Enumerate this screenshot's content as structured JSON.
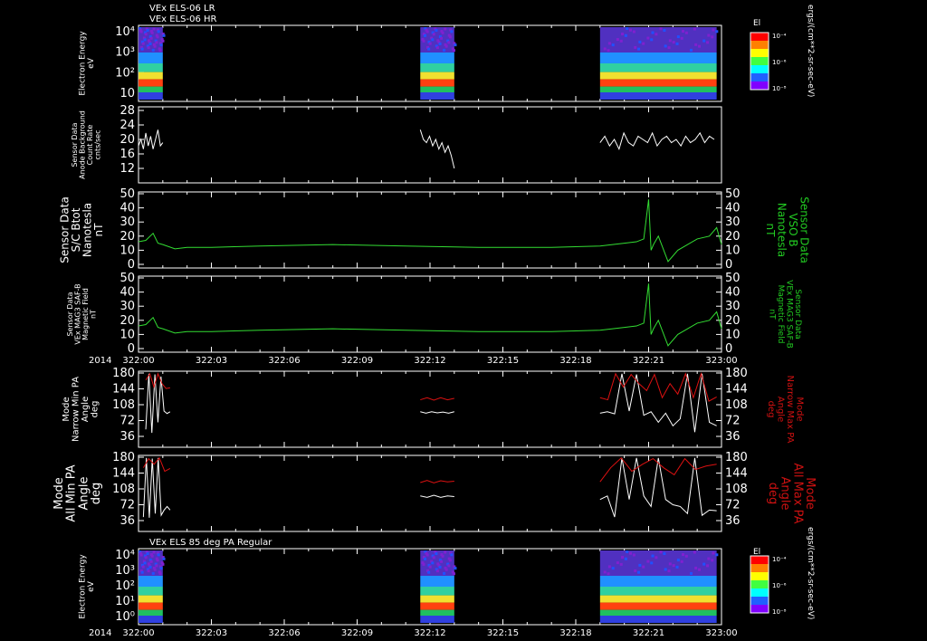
{
  "header": {
    "title_lr": "VEx ELS-06 LR",
    "title_hr": "VEx ELS-06 HR",
    "bottom_title": "VEx ELS 85 deg PA Regular"
  },
  "colors": {
    "background": "#000000",
    "trace_white": "#ffffff",
    "trace_green": "#33dd33",
    "trace_red": "#dd1111",
    "label_green": "#22cc22",
    "label_red": "#cc1111"
  },
  "colorbar": {
    "label": "El",
    "ticks_top": [
      "10⁻⁴",
      "10⁻⁶",
      "10⁻⁸"
    ],
    "ticks_bottom": [
      "10⁻⁴",
      "10⁻⁶",
      "10⁻⁸"
    ],
    "unit": "ergs/(cm**2-sr-sec-eV)"
  },
  "time_axis": {
    "year": "2014",
    "ticks": [
      "322:00",
      "322:03",
      "322:06",
      "322:09",
      "322:12",
      "322:15",
      "322:18",
      "322:21",
      "323:00"
    ]
  },
  "chart_data": [
    {
      "type": "heatmap",
      "name": "spec1",
      "ylabel": "Electron Energy\neV",
      "yscale": "log",
      "ytick_labels": [
        "10⁴",
        "10³",
        "10²",
        "10"
      ],
      "ylim": [
        1,
        20000
      ],
      "segments": [
        {
          "x": [
            "322:00",
            "322:01"
          ]
        },
        {
          "x": [
            "322:11:5",
            "322:13:2"
          ]
        },
        {
          "x": [
            "322:19",
            "322:23:5"
          ]
        }
      ]
    },
    {
      "type": "line",
      "name": "bg",
      "ylabel": "Sensor Data\nAnode Background\nCount Rate\ncnts/sec",
      "ytick_labels": [
        "28",
        "24",
        "20",
        "16",
        "12"
      ],
      "ylim": [
        10,
        28
      ],
      "series": [
        {
          "color": "#ffffff",
          "segments": [
            {
              "x": [
                0,
                1
              ],
              "y": [
                17,
                19,
                16,
                21,
                17,
                20,
                16,
                19,
                22,
                17,
                18
              ]
            },
            {
              "x": [
                11.6,
                13
              ],
              "y": [
                22,
                19,
                18,
                20,
                17,
                19,
                16,
                18,
                15,
                17,
                14,
                10
              ]
            },
            {
              "x": [
                19,
                23.7
              ],
              "y": [
                18,
                20,
                17,
                19,
                16,
                21,
                18,
                17,
                20,
                19,
                18,
                21,
                17,
                19,
                20,
                18,
                19,
                17,
                20,
                18,
                19,
                21,
                18,
                20,
                19
              ]
            }
          ]
        }
      ]
    },
    {
      "type": "line",
      "name": "bmag",
      "ylabel": "Sensor Data\nS/C Btot\nNanotesla\nnT",
      "right_label": "Sensor Data\nVSO B\nNanotesla\nnT",
      "ytick_labels": [
        "50",
        "40",
        "30",
        "20",
        "10",
        "0"
      ],
      "ylim": [
        0,
        50
      ],
      "x": [
        0,
        0.3,
        0.6,
        0.8,
        1.0,
        1.5,
        2.0,
        3.0,
        5.0,
        8.0,
        11.0,
        14.0,
        17.0,
        19.0,
        20.0,
        20.5,
        20.8,
        21.0,
        21.1,
        21.2,
        21.4,
        21.8,
        22.2,
        22.6,
        23.0,
        23.5,
        23.8,
        24.0
      ],
      "series": [
        {
          "color": "#33dd33",
          "values": [
            16,
            17,
            22,
            15,
            14,
            11,
            12,
            12,
            13,
            14,
            13,
            12,
            12,
            13,
            15,
            16,
            18,
            46,
            10,
            14,
            20,
            2,
            10,
            14,
            18,
            20,
            26,
            14
          ]
        }
      ]
    },
    {
      "type": "line",
      "name": "bmag3",
      "ylabel": "Sensor Data\nVEx MAG3 SAF-B\nMagnetic Field\nnT",
      "right_label": "Sensor Data\nVEx MAG3 SAF-B\nMagnetic Field\nnT",
      "ytick_labels": [
        "50",
        "40",
        "30",
        "20",
        "10",
        "0"
      ],
      "ylim": [
        0,
        50
      ],
      "x": [
        0,
        0.3,
        0.6,
        0.8,
        1.0,
        1.5,
        2.0,
        3.0,
        5.0,
        8.0,
        11.0,
        14.0,
        17.0,
        19.0,
        20.0,
        20.5,
        20.8,
        21.0,
        21.1,
        21.2,
        21.4,
        21.8,
        22.2,
        22.6,
        23.0,
        23.5,
        23.8,
        24.0
      ],
      "series": [
        {
          "color": "#33dd33",
          "values": [
            16,
            17,
            22,
            15,
            14,
            11,
            12,
            12,
            13,
            14,
            13,
            12,
            12,
            13,
            15,
            16,
            18,
            46,
            10,
            14,
            20,
            2,
            10,
            14,
            18,
            20,
            26,
            14
          ]
        }
      ]
    },
    {
      "type": "line",
      "name": "pa_narrow",
      "ylabel": "Mode\nNarrow Min PA\nAngle\ndeg",
      "right_label": "Mode\nNarrow Max PA\nAngle\ndeg",
      "ytick_labels": [
        "180",
        "144",
        "108",
        "72",
        "36"
      ],
      "ylim": [
        0,
        180
      ],
      "series": [
        {
          "color": "#ffffff",
          "segments": [
            {
              "x": [
                0.3,
                1.3
              ],
              "y": [
                20,
                178,
                10,
                176,
                40,
                170,
                72,
                65,
                70
              ]
            },
            {
              "x": [
                11.6,
                13.0
              ],
              "y": [
                70,
                66,
                70,
                67,
                69,
                66,
                70
              ]
            },
            {
              "x": [
                19.0,
                23.8
              ],
              "y": [
                66,
                70,
                64,
                178,
                72,
                176,
                60,
                70,
                40,
                66,
                30,
                50,
                178,
                12,
                178,
                40,
                30
              ]
            }
          ]
        },
        {
          "color": "#dd1111",
          "segments": [
            {
              "x": [
                0.3,
                1.3
              ],
              "y": [
                160,
                178,
                140,
                178,
                150,
                136,
                138
              ]
            },
            {
              "x": [
                11.6,
                13.0
              ],
              "y": [
                104,
                110,
                103,
                110,
                104,
                108
              ]
            },
            {
              "x": [
                19.0,
                23.8
              ],
              "y": [
                110,
                104,
                178,
                140,
                176,
                150,
                130,
                176,
                110,
                150,
                120,
                178,
                110,
                178,
                100,
                112
              ]
            }
          ]
        }
      ]
    },
    {
      "type": "line",
      "name": "pa_all",
      "ylabel": "Mode\nAll Min PA\nAngle\ndeg",
      "right_label": "Mode\nAll Max PA\nAngle\ndeg",
      "ytick_labels": [
        "180",
        "144",
        "108",
        "72",
        "36"
      ],
      "ylim": [
        0,
        180
      ],
      "series": [
        {
          "color": "#ffffff",
          "segments": [
            {
              "x": [
                0.2,
                1.3
              ],
              "y": [
                10,
                178,
                8,
                176,
                20,
                178,
                15,
                30,
                40,
                30
              ]
            },
            {
              "x": [
                11.6,
                13.0
              ],
              "y": [
                70,
                66,
                72,
                66,
                70,
                68
              ]
            },
            {
              "x": [
                19.0,
                23.8
              ],
              "y": [
                60,
                70,
                10,
                178,
                60,
                178,
                70,
                40,
                178,
                60,
                45,
                40,
                20,
                178,
                15,
                30,
                28
              ]
            }
          ]
        },
        {
          "color": "#dd1111",
          "segments": [
            {
              "x": [
                0.2,
                1.3
              ],
              "y": [
                150,
                176,
                160,
                178,
                140,
                148
              ]
            },
            {
              "x": [
                11.6,
                13.0
              ],
              "y": [
                108,
                114,
                107,
                113,
                110,
                112
              ]
            },
            {
              "x": [
                19.0,
                23.8
              ],
              "y": [
                110,
                150,
                178,
                140,
                160,
                176,
                150,
                130,
                176,
                145,
                155,
                160
              ]
            }
          ]
        }
      ]
    },
    {
      "type": "heatmap",
      "name": "spec2",
      "ylabel": "Electron Energy\neV",
      "yscale": "log",
      "ytick_labels": [
        "10⁴",
        "10³",
        "10²",
        "10¹",
        "10⁰"
      ],
      "ylim": [
        1,
        20000
      ],
      "segments": [
        {
          "x": [
            "322:00",
            "322:01"
          ]
        },
        {
          "x": [
            "322:11:5",
            "322:13:2"
          ]
        },
        {
          "x": [
            "322:19",
            "322:23:5"
          ]
        }
      ]
    }
  ]
}
